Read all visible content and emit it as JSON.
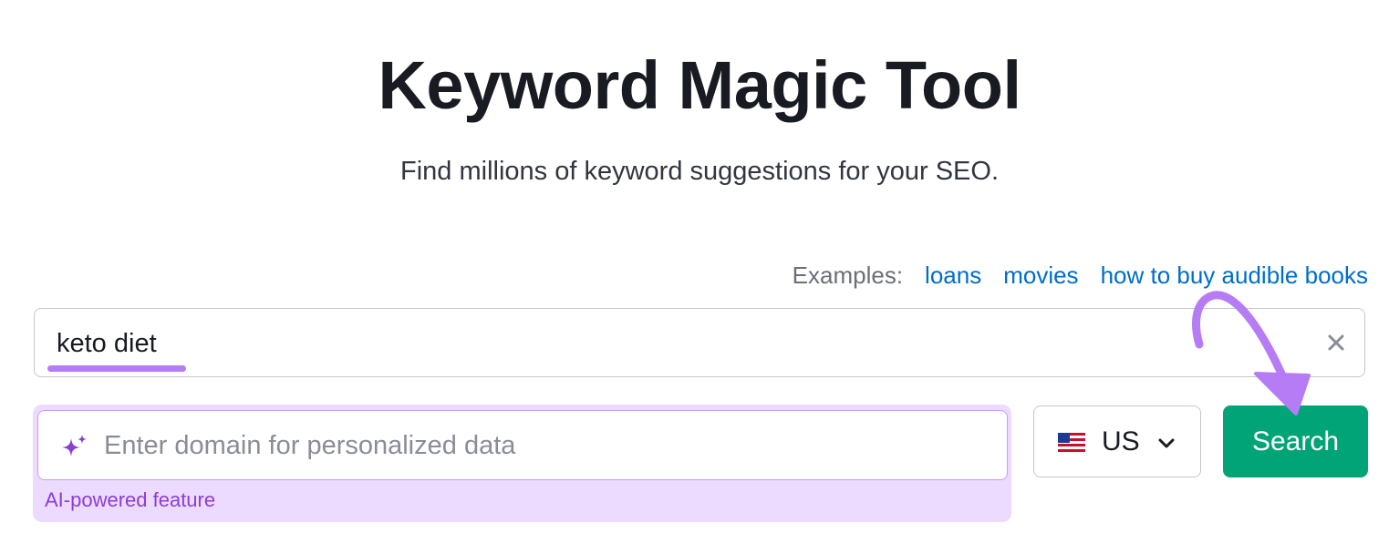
{
  "header": {
    "title": "Keyword Magic Tool",
    "subtitle": "Find millions of keyword suggestions for your SEO."
  },
  "examples": {
    "label": "Examples:",
    "links": [
      "loans",
      "movies",
      "how to buy audible books"
    ]
  },
  "keyword_input": {
    "value": "keto diet",
    "clear_icon": "close-icon"
  },
  "ai_domain": {
    "placeholder": "Enter domain for personalized data",
    "icon": "sparkle-icon",
    "feature_label": "AI-powered feature"
  },
  "database_select": {
    "value": "US",
    "flag_icon": "us-flag-icon",
    "chevron_icon": "chevron-down-icon"
  },
  "search_button": {
    "label": "Search"
  },
  "colors": {
    "accent_purple": "#b67cf5",
    "search_green": "#00a477",
    "link_blue": "#006dca",
    "ai_background": "#ecdaff"
  }
}
